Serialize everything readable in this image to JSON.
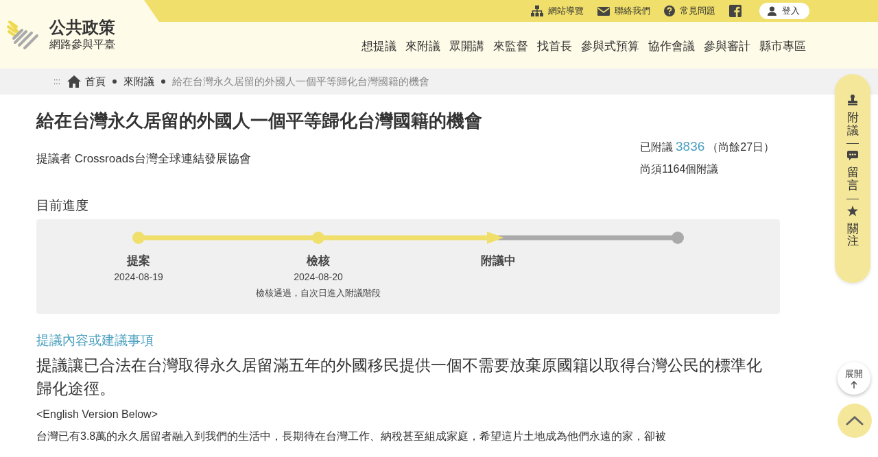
{
  "logo": {
    "title": "公共政策",
    "subtitle": "網路參與平臺"
  },
  "top_links": [
    {
      "label": "網站導覽"
    },
    {
      "label": "聯絡我們"
    },
    {
      "label": "常見問題"
    }
  ],
  "login": {
    "label": "登入"
  },
  "nav": [
    "想提議",
    "來附議",
    "眾開講",
    "來監督",
    "找首長",
    "參與式預算",
    "協作會議",
    "參與審計",
    "縣市專區"
  ],
  "breadcrumb": {
    "marker": ":::",
    "items": [
      {
        "label": "首頁",
        "kind": "home"
      },
      {
        "label": "來附議",
        "kind": "link"
      },
      {
        "label": "給在台灣永久居留的外國人一個平等歸化台灣國籍的機會",
        "kind": "current"
      }
    ]
  },
  "proposal": {
    "title": "給在台灣永久居留的外國人一個平等歸化台灣國籍的機會",
    "proposer": "提議者 Crossroads台灣全球連結發展協會",
    "endorsed_label": "已附議",
    "endorsed_count": "3836",
    "days_left": "（尚餘27日）",
    "needed": "尚須1164個附議"
  },
  "progress": {
    "heading": "目前進度",
    "stages": [
      {
        "name": "提案",
        "date": "2024-08-19",
        "reached": true,
        "current": false
      },
      {
        "name": "檢核",
        "date": "2024-08-20",
        "note": "檢核通過，自次日進入附議階段",
        "reached": true,
        "current": false
      },
      {
        "name": "附議中",
        "reached": true,
        "current": true
      },
      {
        "reached": false,
        "current": false
      }
    ]
  },
  "content": {
    "heading": "提議內容或建議事項",
    "summary": "提議讓已合法在台灣取得永久居留滿五年的外國移民提供一個不需要放棄原國籍以取得台灣公民的標準化歸化途徑。",
    "paragraphs": [
      "<English Version Below>",
      "台灣已有3.8萬的永久居留者融入到我們的生活中，長期待在台灣工作、納稅甚至組成家庭，希望這片土地成為他們永遠的家，卻被"
    ]
  },
  "side_actions": [
    {
      "label": "附議"
    },
    {
      "label": "留言"
    },
    {
      "label": "關注"
    }
  ],
  "expand_button": {
    "label": "展開"
  }
}
